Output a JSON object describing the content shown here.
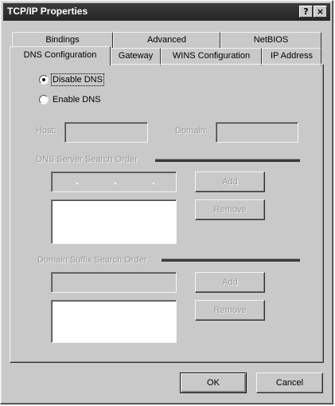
{
  "window": {
    "title": "TCP/IP Properties"
  },
  "titlebar_buttons": {
    "help": "?",
    "close": "×"
  },
  "tabs_back": [
    "Bindings",
    "Advanced",
    "NetBIOS"
  ],
  "tabs_front": [
    "DNS Configuration",
    "Gateway",
    "WINS Configuration",
    "IP Address"
  ],
  "active_tab": "DNS Configuration",
  "dns": {
    "disable_label": "Disable DNS",
    "enable_label": "Enable DNS",
    "selected": "disable"
  },
  "host_label": "Host:",
  "domain_label": "Domain:",
  "server_group_label": "DNS Server Search Order",
  "suffix_group_label": "Domain Suffix Search Order",
  "ip_dots": [
    ".",
    ".",
    "."
  ],
  "buttons": {
    "add": "Add",
    "remove": "Remove",
    "ok": "OK",
    "cancel": "Cancel"
  },
  "colors": {
    "face": "#c9c9c9",
    "titlebar": "#2e2e2e",
    "disabled_text": "#9a9a9a"
  }
}
